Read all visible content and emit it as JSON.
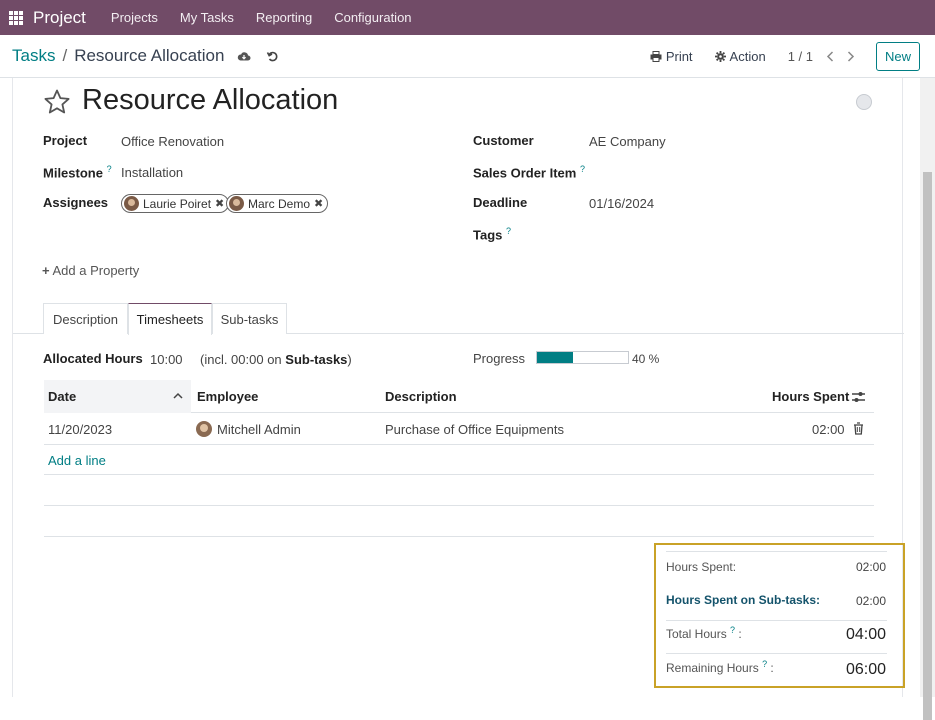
{
  "navbar": {
    "brand": "Project",
    "menu": [
      "Projects",
      "My Tasks",
      "Reporting",
      "Configuration"
    ]
  },
  "control_panel": {
    "breadcrumb_parent": "Tasks",
    "breadcrumb_sep": "/",
    "breadcrumb_current": "Resource Allocation",
    "print_label": "Print",
    "action_label": "Action",
    "pager": "1 / 1",
    "new_label": "New"
  },
  "task": {
    "title": "Resource Allocation",
    "fields_left": {
      "project_label": "Project",
      "project_value": "Office Renovation",
      "milestone_label": "Milestone",
      "milestone_value": "Installation",
      "assignees_label": "Assignees",
      "assignees": [
        "Laurie Poiret",
        "Marc Demo"
      ]
    },
    "fields_right": {
      "customer_label": "Customer",
      "customer_value": "AE Company",
      "sales_order_label": "Sales Order Item",
      "deadline_label": "Deadline",
      "deadline_value": "01/16/2024",
      "tags_label": "Tags"
    },
    "help_mark": "?",
    "add_property": "Add a Property"
  },
  "tabs": [
    "Description",
    "Timesheets",
    "Sub-tasks"
  ],
  "timesheets": {
    "allocated_label": "Allocated Hours",
    "allocated_value": "10:00",
    "note_prefix": "(incl. 00:00 on ",
    "note_bold": "Sub-tasks",
    "note_suffix": ")",
    "progress_label": "Progress",
    "progress_pct": 40,
    "progress_text": "40 %",
    "columns": [
      "Date",
      "Employee",
      "Description",
      "Hours Spent"
    ],
    "rows": [
      {
        "date": "11/20/2023",
        "employee": "Mitchell Admin",
        "description": "Purchase of Office Equipments",
        "hours": "02:00"
      }
    ],
    "add_line": "Add a line"
  },
  "totals": {
    "hours_spent_label": "Hours Spent:",
    "hours_spent_value": "02:00",
    "subtasks_label": "Hours Spent on Sub-tasks:",
    "subtasks_value": "02:00",
    "total_label": "Total Hours",
    "total_value": "04:00",
    "remaining_label": "Remaining Hours",
    "remaining_value": "06:00",
    "suffix": " :"
  },
  "colors": {
    "navbar": "#714b67",
    "accent": "#017e84",
    "highlight_border": "#c9a227"
  }
}
